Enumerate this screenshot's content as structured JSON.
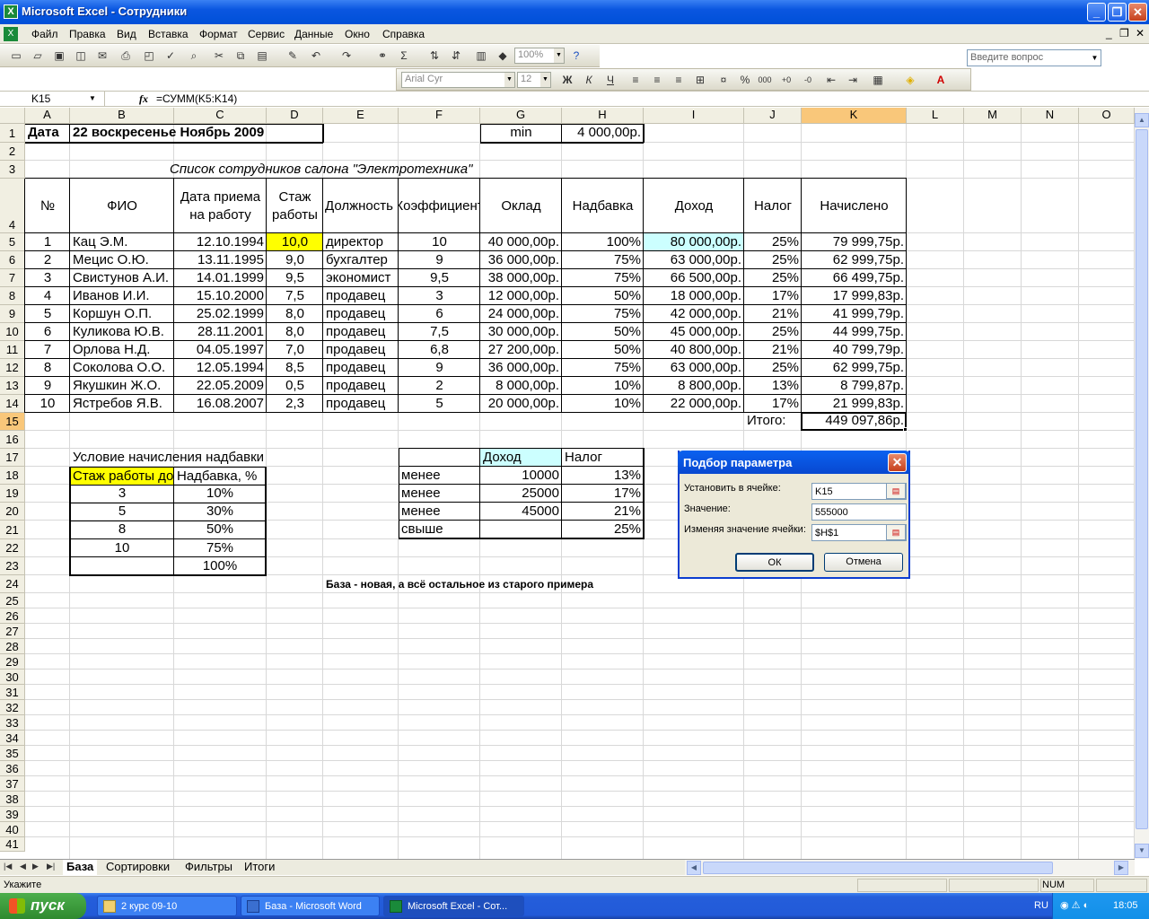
{
  "window": {
    "title": "Microsoft Excel - Сотрудники"
  },
  "menu": {
    "items": [
      "Файл",
      "Правка",
      "Вид",
      "Вставка",
      "Формат",
      "Сервис",
      "Данные",
      "Окно",
      "Справка"
    ],
    "help_placeholder": "Введите вопрос"
  },
  "toolbar": {
    "zoom": "100%",
    "font": "Arial Cyr",
    "size": "12"
  },
  "formula_bar": {
    "name_box": "K15",
    "fx": "fx",
    "formula": "=СУММ(K5:K14)"
  },
  "columns": [
    "A",
    "B",
    "C",
    "D",
    "E",
    "F",
    "G",
    "H",
    "I",
    "J",
    "K",
    "L",
    "M",
    "N",
    "O"
  ],
  "rows": [
    "1",
    "2",
    "3",
    "4",
    "5",
    "6",
    "7",
    "8",
    "9",
    "10",
    "11",
    "12",
    "13",
    "14",
    "15",
    "16",
    "17",
    "18",
    "19",
    "20",
    "21",
    "22",
    "23",
    "24",
    "25",
    "26",
    "27",
    "28",
    "29",
    "30",
    "31",
    "32",
    "33",
    "34",
    "35",
    "36",
    "37",
    "38",
    "39",
    "40",
    "41"
  ],
  "sheet": {
    "a1": "Дата",
    "b1": "22 воскресенье Ноябрь 2009",
    "g1": "min",
    "h1": "4 000,00р.",
    "title": "Список сотрудников салона \"Электротехника\"",
    "headers": [
      "№",
      "ФИО",
      "Дата приема на работу",
      "Стаж работы",
      "Должность",
      "Коэффициент",
      "Оклад",
      "Надбавка",
      "Доход",
      "Налог",
      "Начислено"
    ],
    "employees": [
      [
        "1",
        "Кац Э.М.",
        "12.10.1994",
        "10,0",
        "директор",
        "10",
        "40 000,00р.",
        "100%",
        "80 000,00р.",
        "25%",
        "79 999,75р."
      ],
      [
        "2",
        "Мецис О.Ю.",
        "13.11.1995",
        "9,0",
        "бухгалтер",
        "9",
        "36 000,00р.",
        "75%",
        "63 000,00р.",
        "25%",
        "62 999,75р."
      ],
      [
        "3",
        "Свистунов А.И.",
        "14.01.1999",
        "9,5",
        "экономист",
        "9,5",
        "38 000,00р.",
        "75%",
        "66 500,00р.",
        "25%",
        "66 499,75р."
      ],
      [
        "4",
        "Иванов И.И.",
        "15.10.2000",
        "7,5",
        "продавец",
        "3",
        "12 000,00р.",
        "50%",
        "18 000,00р.",
        "17%",
        "17 999,83р."
      ],
      [
        "5",
        "Коршун О.П.",
        "25.02.1999",
        "8,0",
        "продавец",
        "6",
        "24 000,00р.",
        "75%",
        "42 000,00р.",
        "21%",
        "41 999,79р."
      ],
      [
        "6",
        "Куликова Ю.В.",
        "28.11.2001",
        "8,0",
        "продавец",
        "7,5",
        "30 000,00р.",
        "50%",
        "45 000,00р.",
        "25%",
        "44 999,75р."
      ],
      [
        "7",
        "Орлова Н.Д.",
        "04.05.1997",
        "7,0",
        "продавец",
        "6,8",
        "27 200,00р.",
        "50%",
        "40 800,00р.",
        "21%",
        "40 799,79р."
      ],
      [
        "8",
        "Соколова О.О.",
        "12.05.1994",
        "8,5",
        "продавец",
        "9",
        "36 000,00р.",
        "75%",
        "63 000,00р.",
        "25%",
        "62 999,75р."
      ],
      [
        "9",
        "Якушкин Ж.О.",
        "22.05.2009",
        "0,5",
        "продавец",
        "2",
        "8 000,00р.",
        "10%",
        "8 800,00р.",
        "13%",
        "8 799,87р."
      ],
      [
        "10",
        "Ястребов Я.В.",
        "16.08.2007",
        "2,3",
        "продавец",
        "5",
        "20 000,00р.",
        "10%",
        "22 000,00р.",
        "17%",
        "21 999,83р."
      ]
    ],
    "total_label": "Итого:",
    "total_value": "449 097,86р.",
    "bonus_title": "Условие начисления надбавки",
    "bonus_headers": [
      "Стаж работы до",
      "Надбавка, %"
    ],
    "bonus_rows": [
      [
        "3",
        "10%"
      ],
      [
        "5",
        "30%"
      ],
      [
        "8",
        "50%"
      ],
      [
        "10",
        "75%"
      ],
      [
        "",
        "100%"
      ]
    ],
    "tax_headers": [
      "",
      "Доход",
      "Налог"
    ],
    "tax_rows": [
      [
        "менее",
        "10000",
        "13%"
      ],
      [
        "менее",
        "25000",
        "17%"
      ],
      [
        "менее",
        "45000",
        "21%"
      ],
      [
        "свыше",
        "",
        "25%"
      ]
    ],
    "note": "База  -  новая, а всё остальное из старого примера"
  },
  "dialog": {
    "title": "Подбор параметра",
    "set_cell_label": "Установить в ячейке:",
    "set_cell": "K15",
    "value_label": "Значение:",
    "value": "555000",
    "changing_label": "Изменяя значение ячейки:",
    "changing": "$H$1",
    "ok": "ОК",
    "cancel": "Отмена"
  },
  "tabs": [
    "База",
    "Сортировки",
    "Фильтры",
    "Итоги"
  ],
  "status": {
    "left": "Укажите",
    "num": "NUM"
  },
  "taskbar": {
    "start": "пуск",
    "tasks": [
      "2 курс 09-10",
      "База - Microsoft Word",
      "Microsoft Excel - Сот..."
    ],
    "lang": "RU",
    "time": "18:05"
  },
  "colors": {
    "selected_header": "#f9c77a",
    "yellow": "#ffff00",
    "cyan": "#ccffff"
  }
}
